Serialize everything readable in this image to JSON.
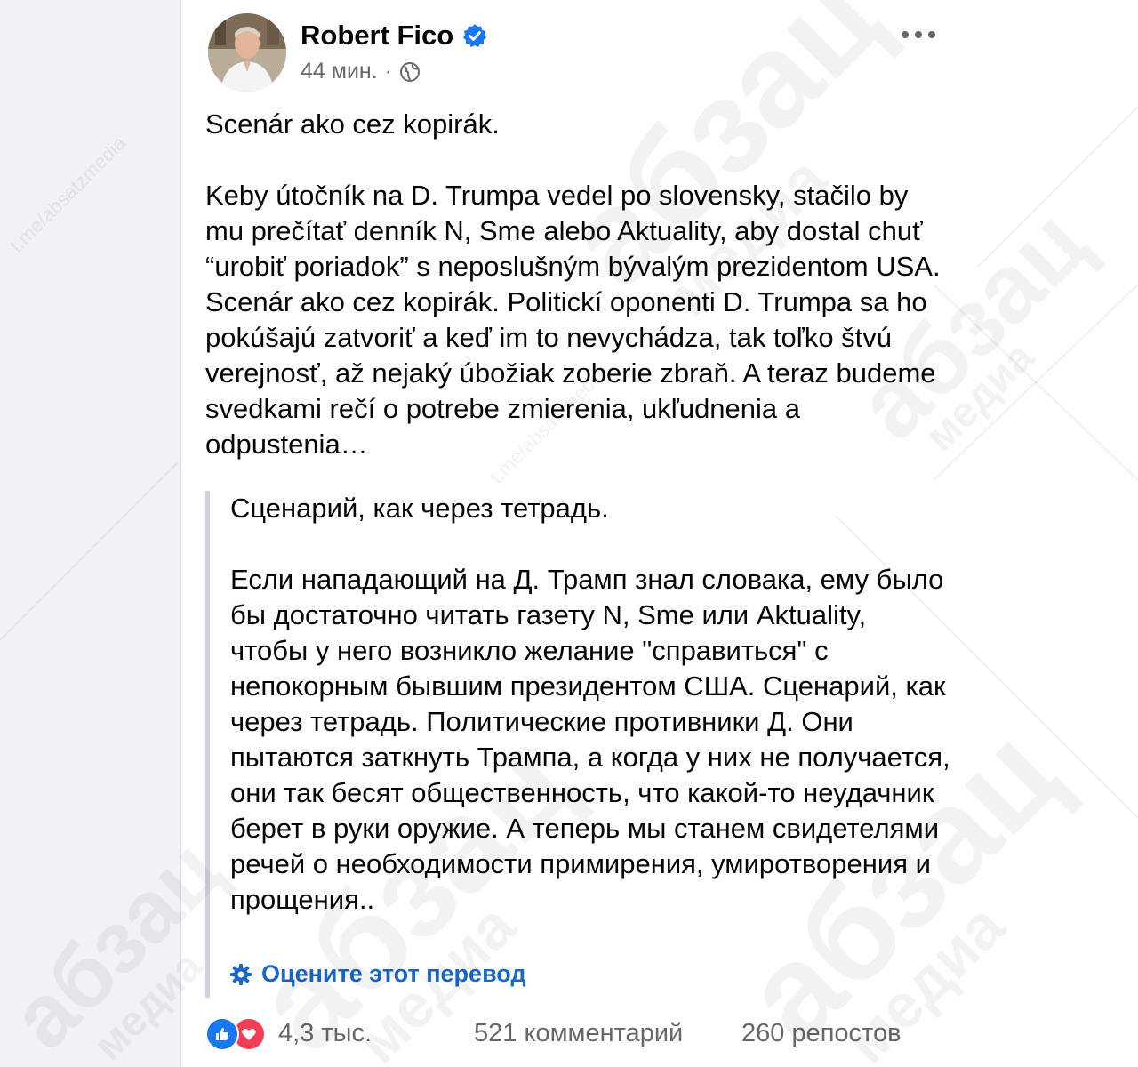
{
  "post": {
    "author": "Robert Fico",
    "time": "44 мин.",
    "separator": "·",
    "text": "Scenár ako cez kopirák.\n\nKeby útočník na D. Trumpa vedel po slovensky, stačilo by mu prečítať denník N, Sme alebo Aktuality, aby dostal chuť  “urobiť poriadok” s neposlušným bývalým prezidentom USA. Scenár ako cez kopirák. Politickí oponenti D. Trumpa sa ho pokúšajú zatvoriť a keď im to nevychádza, tak toľko štvú verejnosť, až nejaký úbožiak zoberie zbraň. A teraz budeme svedkami rečí o potrebe zmierenia, ukľudnenia a odpustenia…",
    "translation": "Сценарий, как через тетрадь.\n\nЕсли нападающий на Д. Трамп знал словака, ему было бы достаточно читать газету N, Sme или Aktuality, чтобы у него возникло желание \"справиться\" с непокорным бывшим президентом США. Сценарий, как через тетрадь. Политические противники Д. Они пытаются заткнуть Трампа, а когда у них не получается, они так бесят общественность, что какой-то неудачник берет в руки оружие. А теперь мы станем свидетелями речей о необходимости примирения, умиротворения и прощения..",
    "rate_translation": "Оцените этот перевод"
  },
  "footer": {
    "reactions": "4,3 тыс.",
    "comments": "521 комментарий",
    "shares": "260 репостов"
  },
  "watermarks": {
    "channel": "t.me/absatzmedia",
    "brand": "абзац",
    "brand_sub": "медиа"
  },
  "colors": {
    "link": "#1b66c9",
    "verified": "#1877f2",
    "like": "#1877f2",
    "love": "#f33e58",
    "muted": "#65676b"
  },
  "icons": [
    "verified-badge-icon",
    "globe-icon",
    "more-options-icon",
    "gear-icon",
    "like-reaction-icon",
    "love-reaction-icon"
  ]
}
